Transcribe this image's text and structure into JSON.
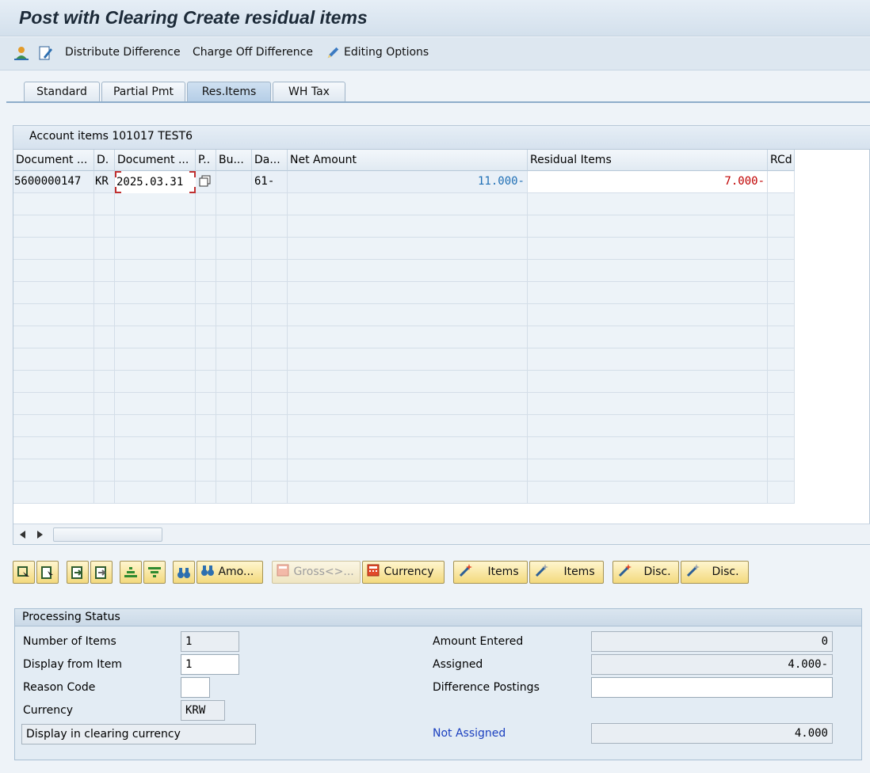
{
  "window": {
    "title": "Post with Clearing Create residual items"
  },
  "toolbar": {
    "distribute_difference": "Distribute Difference",
    "charge_off_difference": "Charge Off Difference",
    "editing_options": "Editing Options"
  },
  "tabs": [
    "Standard",
    "Partial Pmt",
    "Res.Items",
    "WH Tax"
  ],
  "grid": {
    "title": "Account items 101017 TEST6",
    "columns": [
      "Document ...",
      "D.",
      "Document ...",
      "P..",
      "Bu...",
      "Da...",
      "Net Amount",
      "Residual Items",
      "RCd"
    ],
    "rows": [
      {
        "doc_no": "5600000147",
        "doc_type": "KR",
        "doc_date": "2025.03.31",
        "days": "61-",
        "net_amount": "11.000-",
        "residual": "7.000-"
      }
    ]
  },
  "buttons": {
    "amount": "Amo...",
    "gross": "Gross<>...",
    "currency": "Currency",
    "items_1": "Items",
    "items_2": "Items",
    "disc_1": "Disc.",
    "disc_2": "Disc."
  },
  "status": {
    "title": "Processing Status",
    "number_of_items_label": "Number of Items",
    "number_of_items": "1",
    "display_from_item_label": "Display from Item",
    "display_from_item": "1",
    "reason_code_label": "Reason Code",
    "currency_label": "Currency",
    "currency": "KRW",
    "display_clearing_currency": "Display in clearing currency",
    "amount_entered_label": "Amount Entered",
    "amount_entered": "0",
    "assigned_label": "Assigned",
    "assigned": "4.000-",
    "difference_postings_label": "Difference Postings",
    "not_assigned_label": "Not Assigned",
    "not_assigned": "4.000"
  },
  "colors": {
    "net_amount": "#1f6fb5",
    "residual": "#c00000",
    "not_assigned": "#1a3fbf"
  }
}
